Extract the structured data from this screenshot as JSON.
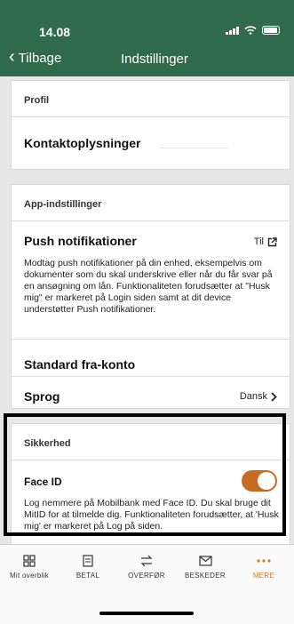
{
  "status": {
    "time": "14.08"
  },
  "nav": {
    "back_label": "Tilbage",
    "title": "Indstillinger"
  },
  "profile": {
    "section_title": "Profil",
    "contact_label": "Kontaktoplysninger"
  },
  "app_settings": {
    "section_title": "App-indstillinger",
    "push": {
      "title": "Push notifikationer",
      "link_label": "Til",
      "description": "Modtag push notifikationer på din enhed, eksempelvis om dokumenter som du skal underskrive eller når du får svar på en ansøgning om lån. Funktionaliteten forudsætter at \"Husk mig\" er markeret på Login siden samt at dit device understøtter Push notifikationer."
    },
    "standard_account": {
      "title": "Standard fra-konto"
    },
    "language": {
      "title": "Sprog",
      "value": "Dansk"
    }
  },
  "security": {
    "section_title": "Sikkerhed",
    "face_id": {
      "title": "Face ID",
      "enabled": true,
      "description": "Log nemmere på Mobilbank med Face ID. Du skal bruge dit MitID for at tilmelde dig. Funktionaliteten forudsætter, at 'Husk mig' er markeret på Log på siden."
    }
  },
  "tabbar": {
    "items": [
      {
        "label": "Mit overblik",
        "icon": "grid-icon"
      },
      {
        "label": "BETAL",
        "icon": "receipt-icon"
      },
      {
        "label": "OVERFØR",
        "icon": "transfer-icon"
      },
      {
        "label": "BESKEDER",
        "icon": "envelope-icon"
      },
      {
        "label": "MERE",
        "icon": "more-icon"
      }
    ],
    "active_index": 4
  },
  "colors": {
    "header": "#2f6b4a",
    "accent": "#d07a2a",
    "toggle": "#c96a23"
  }
}
